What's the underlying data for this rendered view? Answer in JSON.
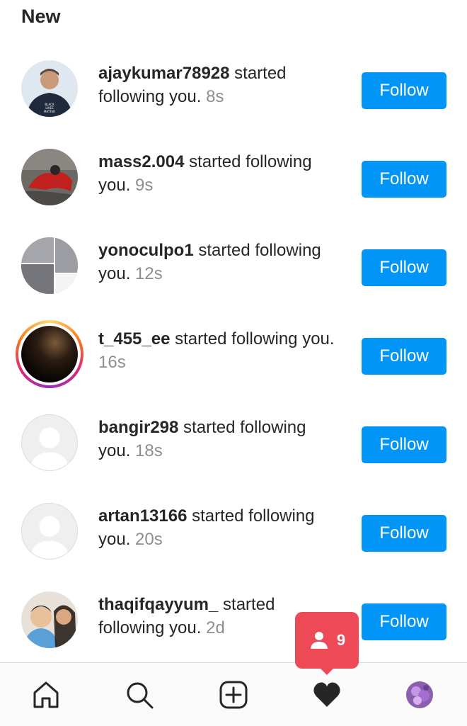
{
  "section": {
    "title": "New"
  },
  "notifications": [
    {
      "username": "ajaykumar78928",
      "action": " started following you.",
      "time": " 8s",
      "button": "Follow"
    },
    {
      "username": "mass2.004",
      "action": " started following you.",
      "time": " 9s",
      "button": "Follow"
    },
    {
      "username": "yonoculpo1",
      "action": " started following you.",
      "time": " 12s",
      "button": "Follow"
    },
    {
      "username": "t_455_ee",
      "action": " started following you.",
      "time": " 16s",
      "button": "Follow"
    },
    {
      "username": "bangir298",
      "action": " started following you.",
      "time": " 18s",
      "button": "Follow"
    },
    {
      "username": "artan13166",
      "action": " started following you.",
      "time": " 20s",
      "button": "Follow"
    },
    {
      "username": "thaqifqayyum_",
      "action": " started following you.",
      "time": " 2d",
      "button": "Follow"
    }
  ],
  "activity_popup": {
    "count": "9",
    "icon": "person-icon"
  },
  "bottom_nav": {
    "items": [
      "home-icon",
      "search-icon",
      "new-post-icon",
      "activity-heart-icon",
      "profile-avatar"
    ]
  },
  "colors": {
    "follow_button": "#0095f6",
    "popup": "#ed4956",
    "secondary_text": "#8e8e8e",
    "story_ring": "#d62976"
  }
}
